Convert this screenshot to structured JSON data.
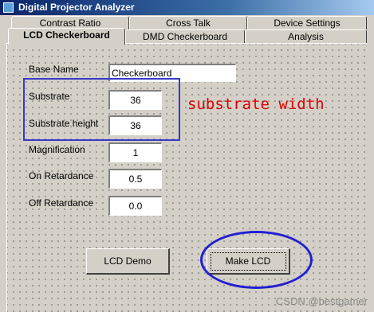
{
  "window": {
    "title": "Digital Projector Analyzer"
  },
  "tabs_row1": [
    {
      "label": "Contrast Ratio"
    },
    {
      "label": "Cross Talk"
    },
    {
      "label": "Device Settings"
    }
  ],
  "tabs_row2": [
    {
      "label": "LCD Checkerboard",
      "active": true
    },
    {
      "label": "DMD Checkerboard"
    },
    {
      "label": "Analysis"
    }
  ],
  "form": {
    "base_name": {
      "label": "Base Name",
      "value": "Checkerboard"
    },
    "substrate_width": {
      "label": "Substrate",
      "value": "36"
    },
    "substrate_height": {
      "label": "Substrate height",
      "value": "36"
    },
    "magnification": {
      "label": "Magnification",
      "value": "1"
    },
    "on_retardance": {
      "label": "On Retardance",
      "value": "0.5"
    },
    "off_retardance": {
      "label": "Off Retardance",
      "value": "0.0"
    }
  },
  "buttons": {
    "lcd_demo": "LCD Demo",
    "make_lcd": "Make LCD"
  },
  "annotation": {
    "text": "substrate width",
    "text_color": "#e00000",
    "box_color": "#3838c8"
  },
  "watermark": "CSDN @bestgamer"
}
